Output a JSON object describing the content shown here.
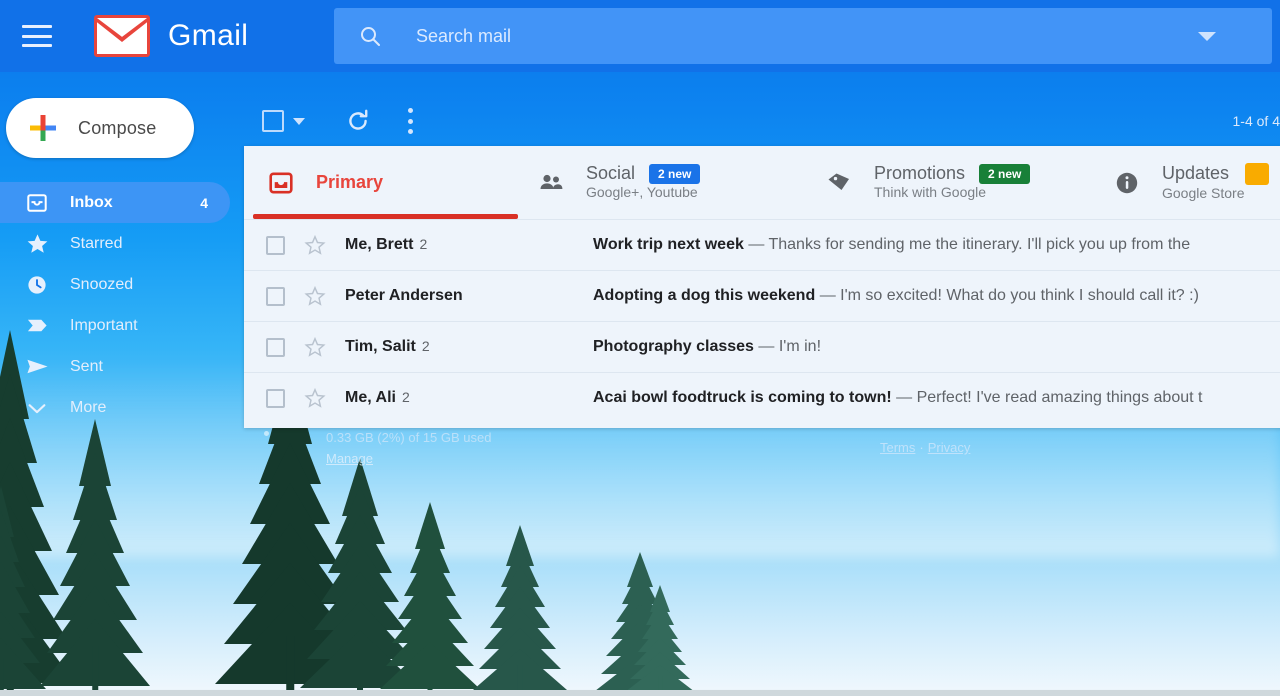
{
  "theme": {
    "header_blue": "#1171e8",
    "search_blue": "#4294f7",
    "accent_red": "#d93025",
    "panel_bg": "#eef4fb"
  },
  "header": {
    "menu_icon": "hamburger-icon",
    "logo_icon": "gmail-logo-icon",
    "title": "Gmail",
    "search": {
      "icon": "search-icon",
      "placeholder": "Search mail",
      "value": "",
      "options_icon": "chevron-down-icon"
    }
  },
  "sidebar": {
    "compose": {
      "icon": "plus-icon",
      "label": "Compose"
    },
    "items": [
      {
        "icon": "inbox-icon",
        "label": "Inbox",
        "count": "4",
        "active": true
      },
      {
        "icon": "star-icon",
        "label": "Starred",
        "count": "",
        "active": false
      },
      {
        "icon": "clock-icon",
        "label": "Snoozed",
        "count": "",
        "active": false
      },
      {
        "icon": "important-icon",
        "label": "Important",
        "count": "",
        "active": false
      },
      {
        "icon": "send-icon",
        "label": "Sent",
        "count": "",
        "active": false
      },
      {
        "icon": "chevron-down-icon",
        "label": "More",
        "count": "",
        "active": false
      }
    ],
    "storage": {
      "text": "0.33 GB (2%) of 15 GB used",
      "manage_label": "Manage"
    }
  },
  "toolbar": {
    "select_all_icon": "checkbox-icon",
    "select_caret_icon": "chevron-down-icon",
    "refresh_icon": "refresh-icon",
    "more_icon": "more-vertical-icon",
    "pager": "1-4 of 4"
  },
  "tabs": [
    {
      "icon": "inbox-icon",
      "name": "Primary",
      "sub": "",
      "badge": "",
      "badge_color": "",
      "active": true
    },
    {
      "icon": "people-icon",
      "name": "Social",
      "sub": "Google+, Youtube",
      "badge": "2 new",
      "badge_color": "#1a73e8",
      "active": false
    },
    {
      "icon": "tag-icon",
      "name": "Promotions",
      "sub": "Think with Google",
      "badge": "2 new",
      "badge_color": "#188038",
      "active": false
    },
    {
      "icon": "info-icon",
      "name": "Updates",
      "sub": "Google Store",
      "badge": "",
      "badge_color": "#f9ab00",
      "active": false
    }
  ],
  "emails": [
    {
      "sender": "Me, Brett",
      "count": "2",
      "subject": "Work trip next week",
      "snippet": "— Thanks for sending me the itinerary. I'll pick you up from the"
    },
    {
      "sender": "Peter Andersen",
      "count": "",
      "subject": "Adopting a dog this weekend",
      "snippet": "— I'm so excited! What do you think I should call it? :)"
    },
    {
      "sender": "Tim, Salit",
      "count": "2",
      "subject": "Photography classes",
      "snippet": "— I'm in!"
    },
    {
      "sender": "Me, Ali",
      "count": "2",
      "subject": "Acai bowl foodtruck is coming to town!",
      "snippet": "— Perfect! I've read amazing things about t"
    }
  ],
  "legal": {
    "terms": "Terms",
    "separator": "·",
    "privacy": "Privacy"
  }
}
